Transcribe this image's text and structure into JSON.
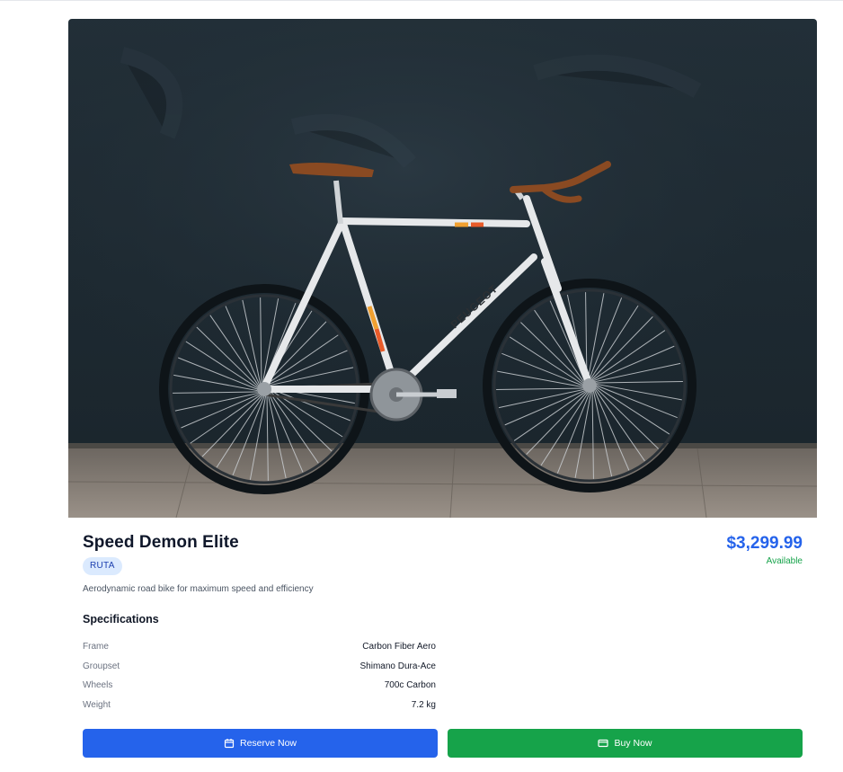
{
  "product": {
    "image_alt": "White Peugeot fixed-gear bicycle against dark wall",
    "frame_lettering": "PEUGEOT",
    "name": "Speed Demon Elite",
    "category_badge": "RUTA",
    "price": "$3,299.99",
    "availability": "Available",
    "description": "Aerodynamic road bike for maximum speed and efficiency"
  },
  "specifications": {
    "heading": "Specifications",
    "rows": [
      {
        "label": "Frame",
        "value": "Carbon Fiber Aero"
      },
      {
        "label": "Groupset",
        "value": "Shimano Dura-Ace"
      },
      {
        "label": "Wheels",
        "value": "700c Carbon"
      },
      {
        "label": "Weight",
        "value": "7.2 kg"
      }
    ]
  },
  "actions": {
    "reserve_label": "Reserve Now",
    "reserve_icon": "calendar-icon",
    "buy_label": "Buy Now",
    "buy_icon": "credit-card-icon"
  },
  "colors": {
    "primary": "#2563eb",
    "success": "#16a34a",
    "badge_bg": "#dbeafe",
    "badge_text": "#1e40af"
  }
}
